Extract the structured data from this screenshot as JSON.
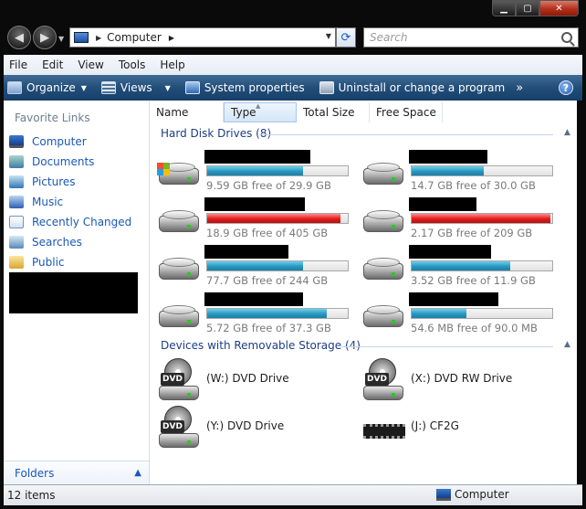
{
  "caption": {
    "minimize_icon": "minimize-icon",
    "maximize_icon": "maximize-icon",
    "close_icon": "close-icon"
  },
  "address": {
    "location": "Computer",
    "search_placeholder": "Search"
  },
  "menu": [
    "File",
    "Edit",
    "View",
    "Tools",
    "Help"
  ],
  "commands": {
    "organize": "Organize",
    "views": "Views",
    "system_properties": "System properties",
    "uninstall": "Uninstall or change a program",
    "more": "»"
  },
  "nav": {
    "favorite_links_header": "Favorite Links",
    "items": [
      "Computer",
      "Documents",
      "Pictures",
      "Music",
      "Recently Changed",
      "Searches",
      "Public"
    ],
    "folders_label": "Folders"
  },
  "columns": [
    "Name",
    "Type",
    "Total Size",
    "Free Space"
  ],
  "groups": {
    "hard_disks": "Hard Disk Drives (8)",
    "removable": "Devices with Removable Storage (4)"
  },
  "drives": [
    {
      "free_text": "9.59 GB free of 29.9 GB",
      "used_fraction": 0.68,
      "status": "normal",
      "system": true
    },
    {
      "free_text": "14.7 GB free of 30.0 GB",
      "used_fraction": 0.51,
      "status": "normal",
      "system": false
    },
    {
      "free_text": "18.9 GB free of 405 GB",
      "used_fraction": 0.95,
      "status": "full",
      "system": false
    },
    {
      "free_text": "2.17 GB free of 209 GB",
      "used_fraction": 0.99,
      "status": "full",
      "system": false
    },
    {
      "free_text": "77.7 GB free of 244 GB",
      "used_fraction": 0.68,
      "status": "normal",
      "system": false
    },
    {
      "free_text": "3.52 GB free of 11.9 GB",
      "used_fraction": 0.7,
      "status": "normal",
      "system": false
    },
    {
      "free_text": "5.72 GB free of 37.3 GB",
      "used_fraction": 0.85,
      "status": "normal",
      "system": false
    },
    {
      "free_text": "54.6 MB free of 90.0 MB",
      "used_fraction": 0.39,
      "status": "normal",
      "system": false
    }
  ],
  "devices": [
    "(W:) DVD Drive",
    "(X:) DVD RW Drive",
    "(Y:) DVD Drive",
    "(J:) CF2G"
  ],
  "status": {
    "item_count": "12 items",
    "location": "Computer"
  },
  "colors": {
    "command_bar": "#224e7a",
    "link": "#1a58b6",
    "group_header": "#1e3d85",
    "bar_normal": "#2897c0",
    "bar_full": "#e11c1c"
  }
}
